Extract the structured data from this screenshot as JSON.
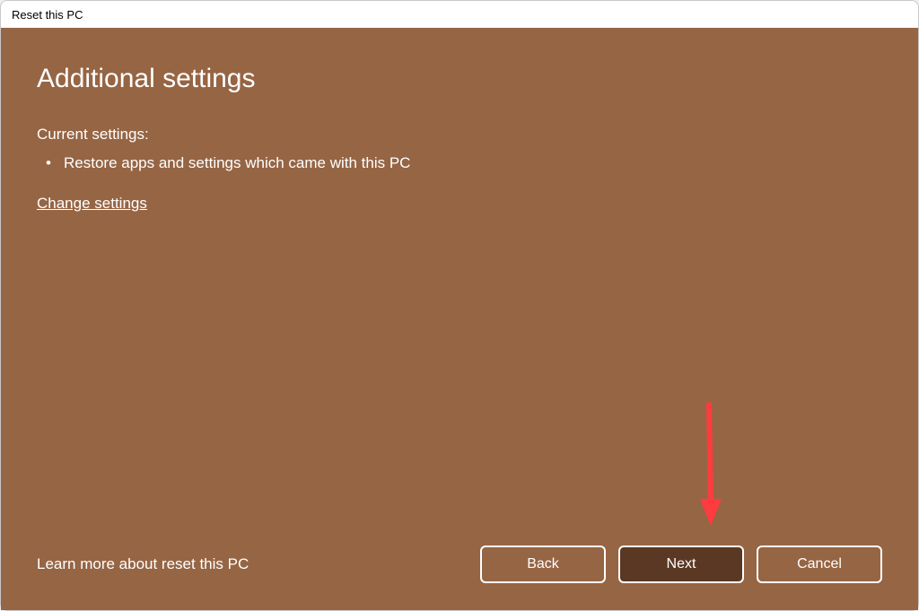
{
  "window": {
    "title": "Reset this PC"
  },
  "content": {
    "heading": "Additional settings",
    "subheading": "Current settings:",
    "bullets": [
      "Restore apps and settings which came with this PC"
    ],
    "change_link": "Change settings",
    "learn_more": "Learn more about reset this PC"
  },
  "buttons": {
    "back": "Back",
    "next": "Next",
    "cancel": "Cancel"
  },
  "annotation": {
    "arrow_color": "#ff3b3f"
  }
}
